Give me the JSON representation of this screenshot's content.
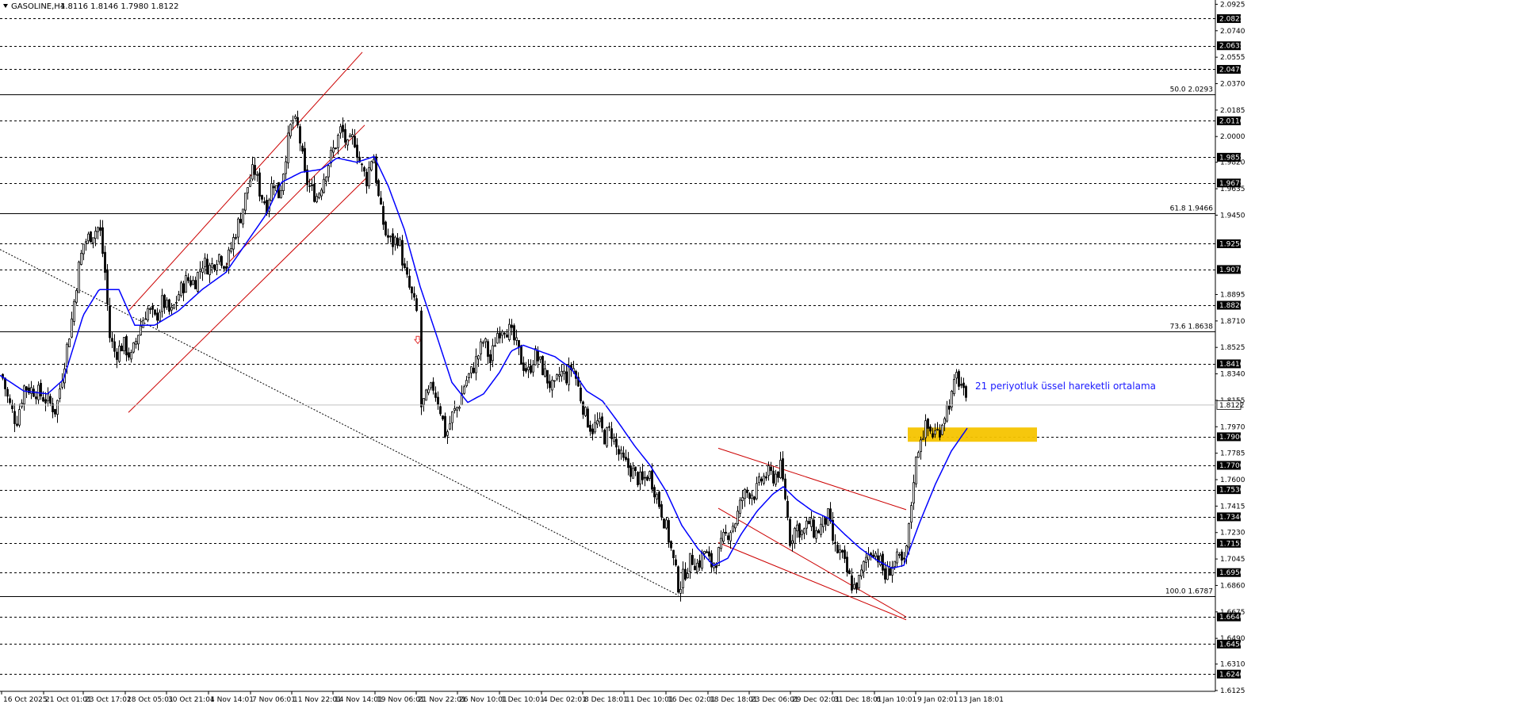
{
  "header": {
    "symbol": "GASOLINE,H4",
    "ohlc": "1.8116 1.8146 1.7980 1.8122"
  },
  "colors": {
    "background": "#ffffff",
    "candle": "#000000",
    "ema": "#0000ff",
    "channel": "#cc0000",
    "zone": "#f5c400",
    "grid": "#000000",
    "label_box": "#000000",
    "arrow": "#e03030"
  },
  "price_axis": {
    "labels": [
      "2.0925",
      "2.0740",
      "2.0555",
      "2.0370",
      "2.0185",
      "2.0000",
      "1.9820",
      "1.9635",
      "1.9450",
      "1.8895",
      "1.8710",
      "1.8525",
      "1.8340",
      "1.8155",
      "1.7970",
      "1.7785",
      "1.7600",
      "1.7415",
      "1.7230",
      "1.7045",
      "1.6860",
      "1.6675",
      "1.6490",
      "1.6310",
      "1.6125"
    ]
  },
  "chart_data": {
    "type": "candlestick",
    "title": "GASOLINE,H4",
    "ylim": [
      1.612,
      2.0955
    ],
    "x_labels": [
      "16 Oct 2025",
      "21 Oct 01:01",
      "23 Oct 17:01",
      "28 Oct 05:01",
      "30 Oct 21:01",
      "4 Nov 14:01",
      "7 Nov 06:01",
      "11 Nov 22:01",
      "14 Nov 14:01",
      "19 Nov 06:01",
      "21 Nov 22:01",
      "26 Nov 10:01",
      "1 Dec 10:01",
      "4 Dec 02:01",
      "8 Dec 18:01",
      "11 Dec 10:01",
      "16 Dec 02:01",
      "18 Dec 18:01",
      "23 Dec 06:01",
      "29 Dec 02:01",
      "31 Dec 18:01",
      "6 Jan 10:01",
      "9 Jan 02:01",
      "13 Jan 18:01"
    ],
    "last_price": "1.8122",
    "horizontal_levels": [
      "2.0825",
      "2.0635",
      "2.0470",
      "2.0110",
      "1.9855",
      "1.9675",
      "1.9250",
      "1.9070",
      "1.8820",
      "1.8410",
      "1.7900",
      "1.7700",
      "1.7530",
      "1.7340",
      "1.7155",
      "1.6950",
      "1.6640",
      "1.6450",
      "1.6240"
    ],
    "fibonacci": [
      {
        "label": "50.0 2.0293",
        "price": 2.0293
      },
      {
        "label": "61.8 1.9466",
        "price": 1.9466
      },
      {
        "label": "73.6 1.8638",
        "price": 1.8638
      },
      {
        "label": "100.0 1.6787",
        "price": 1.6787
      }
    ],
    "annotation": "21 periyotluk üssel hareketli ortalama",
    "close_path": [
      [
        0,
        1.838
      ],
      [
        10,
        1.815
      ],
      [
        20,
        1.8
      ],
      [
        30,
        1.825
      ],
      [
        45,
        1.822
      ],
      [
        60,
        1.815
      ],
      [
        70,
        1.808
      ],
      [
        80,
        1.84
      ],
      [
        90,
        1.872
      ],
      [
        98,
        1.906
      ],
      [
        105,
        1.925
      ],
      [
        115,
        1.932
      ],
      [
        125,
        1.937
      ],
      [
        132,
        1.905
      ],
      [
        138,
        1.86
      ],
      [
        145,
        1.848
      ],
      [
        155,
        1.855
      ],
      [
        165,
        1.845
      ],
      [
        175,
        1.865
      ],
      [
        185,
        1.88
      ],
      [
        195,
        1.872
      ],
      [
        205,
        1.885
      ],
      [
        215,
        1.875
      ],
      [
        225,
        1.89
      ],
      [
        235,
        1.9
      ],
      [
        245,
        1.898
      ],
      [
        255,
        1.912
      ],
      [
        265,
        1.908
      ],
      [
        275,
        1.918
      ],
      [
        285,
        1.91
      ],
      [
        295,
        1.93
      ],
      [
        305,
        1.948
      ],
      [
        312,
        1.965
      ],
      [
        320,
        1.978
      ],
      [
        328,
        1.96
      ],
      [
        336,
        1.952
      ],
      [
        344,
        1.97
      ],
      [
        352,
        1.958
      ],
      [
        360,
        1.988
      ],
      [
        368,
        2.012
      ],
      [
        376,
        2.005
      ],
      [
        384,
        1.972
      ],
      [
        392,
        1.962
      ],
      [
        400,
        1.958
      ],
      [
        408,
        1.972
      ],
      [
        416,
        1.985
      ],
      [
        424,
        1.996
      ],
      [
        430,
        2.006
      ],
      [
        438,
        1.992
      ],
      [
        446,
        2.0
      ],
      [
        454,
        1.98
      ],
      [
        462,
        1.97
      ],
      [
        470,
        1.99
      ],
      [
        478,
        1.952
      ],
      [
        486,
        1.932
      ],
      [
        494,
        1.925
      ],
      [
        502,
        1.93
      ],
      [
        510,
        1.905
      ],
      [
        518,
        1.89
      ],
      [
        526,
        1.875
      ],
      [
        530,
        1.81
      ],
      [
        538,
        1.818
      ],
      [
        546,
        1.825
      ],
      [
        554,
        1.812
      ],
      [
        562,
        1.79
      ],
      [
        570,
        1.805
      ],
      [
        578,
        1.812
      ],
      [
        586,
        1.828
      ],
      [
        594,
        1.835
      ],
      [
        602,
        1.846
      ],
      [
        610,
        1.858
      ],
      [
        618,
        1.842
      ],
      [
        626,
        1.862
      ],
      [
        634,
        1.868
      ],
      [
        642,
        1.864
      ],
      [
        650,
        1.855
      ],
      [
        658,
        1.842
      ],
      [
        666,
        1.835
      ],
      [
        674,
        1.848
      ],
      [
        682,
        1.84
      ],
      [
        690,
        1.83
      ],
      [
        698,
        1.822
      ],
      [
        706,
        1.835
      ],
      [
        714,
        1.832
      ],
      [
        722,
        1.84
      ],
      [
        730,
        1.822
      ],
      [
        738,
        1.805
      ],
      [
        746,
        1.795
      ],
      [
        754,
        1.8
      ],
      [
        762,
        1.79
      ],
      [
        770,
        1.795
      ],
      [
        778,
        1.78
      ],
      [
        786,
        1.772
      ],
      [
        794,
        1.768
      ],
      [
        802,
        1.762
      ],
      [
        810,
        1.758
      ],
      [
        818,
        1.765
      ],
      [
        826,
        1.752
      ],
      [
        834,
        1.738
      ],
      [
        842,
        1.722
      ],
      [
        850,
        1.7
      ],
      [
        856,
        1.684
      ],
      [
        864,
        1.696
      ],
      [
        872,
        1.705
      ],
      [
        880,
        1.7
      ],
      [
        888,
        1.71
      ],
      [
        896,
        1.7
      ],
      [
        904,
        1.705
      ],
      [
        912,
        1.718
      ],
      [
        920,
        1.725
      ],
      [
        928,
        1.732
      ],
      [
        936,
        1.748
      ],
      [
        944,
        1.752
      ],
      [
        952,
        1.75
      ],
      [
        960,
        1.76
      ],
      [
        968,
        1.764
      ],
      [
        976,
        1.762
      ],
      [
        984,
        1.768
      ],
      [
        990,
        1.748
      ],
      [
        996,
        1.718
      ],
      [
        1004,
        1.728
      ],
      [
        1012,
        1.722
      ],
      [
        1020,
        1.73
      ],
      [
        1028,
        1.722
      ],
      [
        1036,
        1.728
      ],
      [
        1044,
        1.734
      ],
      [
        1052,
        1.712
      ],
      [
        1060,
        1.708
      ],
      [
        1068,
        1.695
      ],
      [
        1076,
        1.684
      ],
      [
        1084,
        1.69
      ],
      [
        1092,
        1.705
      ],
      [
        1100,
        1.712
      ],
      [
        1108,
        1.705
      ],
      [
        1116,
        1.692
      ],
      [
        1124,
        1.7
      ],
      [
        1132,
        1.704
      ],
      [
        1140,
        1.7
      ],
      [
        1146,
        1.725
      ],
      [
        1152,
        1.762
      ],
      [
        1160,
        1.79
      ],
      [
        1168,
        1.797
      ],
      [
        1176,
        1.792
      ],
      [
        1184,
        1.794
      ],
      [
        1192,
        1.808
      ],
      [
        1200,
        1.818
      ],
      [
        1206,
        1.832
      ],
      [
        1212,
        1.826
      ],
      [
        1218,
        1.812
      ]
    ],
    "ema_path": [
      [
        0,
        1.833
      ],
      [
        30,
        1.822
      ],
      [
        60,
        1.82
      ],
      [
        80,
        1.83
      ],
      [
        105,
        1.875
      ],
      [
        125,
        1.893
      ],
      [
        150,
        1.893
      ],
      [
        170,
        1.868
      ],
      [
        195,
        1.868
      ],
      [
        225,
        1.878
      ],
      [
        255,
        1.893
      ],
      [
        285,
        1.905
      ],
      [
        310,
        1.925
      ],
      [
        335,
        1.945
      ],
      [
        355,
        1.968
      ],
      [
        380,
        1.975
      ],
      [
        405,
        1.977
      ],
      [
        425,
        1.985
      ],
      [
        450,
        1.982
      ],
      [
        472,
        1.986
      ],
      [
        490,
        1.965
      ],
      [
        510,
        1.935
      ],
      [
        530,
        1.895
      ],
      [
        550,
        1.862
      ],
      [
        570,
        1.828
      ],
      [
        590,
        1.814
      ],
      [
        610,
        1.82
      ],
      [
        630,
        1.835
      ],
      [
        645,
        1.85
      ],
      [
        660,
        1.854
      ],
      [
        680,
        1.85
      ],
      [
        700,
        1.846
      ],
      [
        720,
        1.838
      ],
      [
        740,
        1.822
      ],
      [
        760,
        1.815
      ],
      [
        780,
        1.8
      ],
      [
        800,
        1.784
      ],
      [
        820,
        1.77
      ],
      [
        840,
        1.752
      ],
      [
        860,
        1.728
      ],
      [
        880,
        1.712
      ],
      [
        900,
        1.7
      ],
      [
        918,
        1.705
      ],
      [
        935,
        1.722
      ],
      [
        955,
        1.738
      ],
      [
        975,
        1.75
      ],
      [
        988,
        1.755
      ],
      [
        1005,
        1.746
      ],
      [
        1025,
        1.738
      ],
      [
        1045,
        1.733
      ],
      [
        1065,
        1.722
      ],
      [
        1085,
        1.712
      ],
      [
        1105,
        1.704
      ],
      [
        1125,
        1.698
      ],
      [
        1140,
        1.7
      ],
      [
        1160,
        1.73
      ],
      [
        1180,
        1.757
      ],
      [
        1200,
        1.78
      ],
      [
        1220,
        1.796
      ]
    ]
  }
}
